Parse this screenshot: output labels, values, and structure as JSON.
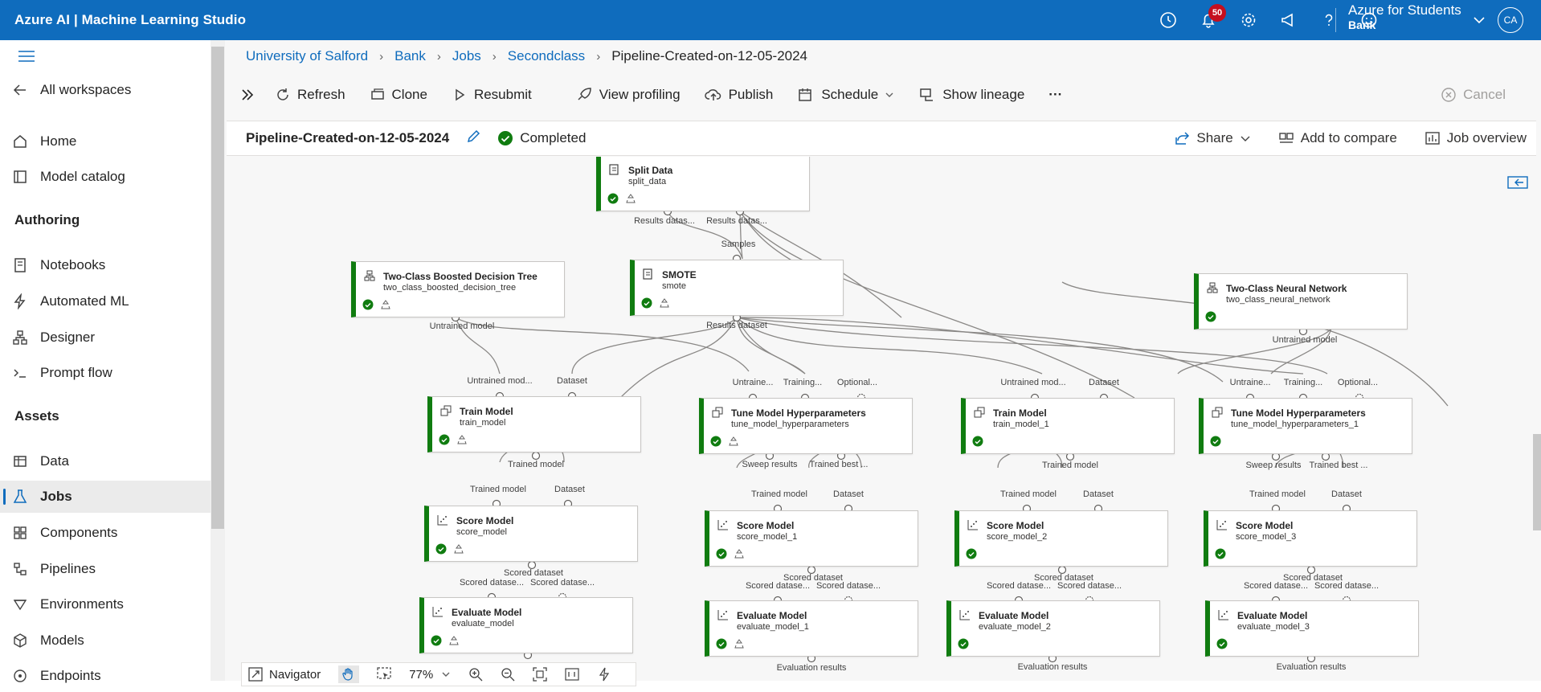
{
  "app": {
    "title": "Azure AI | Machine Learning Studio",
    "notif_count": "50"
  },
  "account": {
    "name": "Azure for Students",
    "workspace": "Bank",
    "initials": "CA"
  },
  "sidebar": {
    "all_workspaces": "All workspaces",
    "items_top": [
      "Home",
      "Model catalog"
    ],
    "authoring_head": "Authoring",
    "authoring": [
      "Notebooks",
      "Automated ML",
      "Designer",
      "Prompt flow"
    ],
    "assets_head": "Assets",
    "assets": [
      "Data",
      "Jobs",
      "Components",
      "Pipelines",
      "Environments",
      "Models",
      "Endpoints"
    ]
  },
  "breadcrumb": [
    "University of Salford",
    "Bank",
    "Jobs",
    "Secondclass",
    "Pipeline-Created-on-12-05-2024"
  ],
  "toolbar": {
    "refresh": "Refresh",
    "clone": "Clone",
    "resubmit": "Resubmit",
    "view_profiling": "View profiling",
    "publish": "Publish",
    "schedule": "Schedule",
    "show_lineage": "Show lineage",
    "more": "···",
    "cancel": "Cancel"
  },
  "job": {
    "name": "Pipeline-Created-on-12-05-2024",
    "status": "Completed",
    "share": "Share",
    "compare": "Add to compare",
    "overview": "Job overview"
  },
  "nodes": {
    "split": {
      "title": "Split Data",
      "sub": "split_data"
    },
    "boosted": {
      "title": "Two-Class Boosted Decision Tree",
      "sub": "two_class_boosted_decision_tree"
    },
    "smote": {
      "title": "SMOTE",
      "sub": "smote"
    },
    "neural": {
      "title": "Two-Class Neural Network",
      "sub": "two_class_neural_network"
    },
    "train": {
      "title": "Train Model",
      "sub": "train_model"
    },
    "tune": {
      "title": "Tune Model Hyperparameters",
      "sub": "tune_model_hyperparameters"
    },
    "train1": {
      "title": "Train Model",
      "sub": "train_model_1"
    },
    "tune1": {
      "title": "Tune Model Hyperparameters",
      "sub": "tune_model_hyperparameters_1"
    },
    "score": {
      "title": "Score Model",
      "sub": "score_model"
    },
    "score1": {
      "title": "Score Model",
      "sub": "score_model_1"
    },
    "score2": {
      "title": "Score Model",
      "sub": "score_model_2"
    },
    "score3": {
      "title": "Score Model",
      "sub": "score_model_3"
    },
    "eval": {
      "title": "Evaluate Model",
      "sub": "evaluate_model"
    },
    "eval1": {
      "title": "Evaluate Model",
      "sub": "evaluate_model_1"
    },
    "eval2": {
      "title": "Evaluate Model",
      "sub": "evaluate_model_2"
    },
    "eval3": {
      "title": "Evaluate Model",
      "sub": "evaluate_model_3"
    }
  },
  "ports": {
    "results_ds1": "Results datas...",
    "results_ds2": "Results datas...",
    "samples": "Samples",
    "untrained_model": "Untrained model",
    "results_dataset": "Results dataset",
    "untrained_mod": "Untrained mod...",
    "dataset": "Dataset",
    "untrained_short": "Untraine...",
    "training": "Training...",
    "optional": "Optional...",
    "trained_model": "Trained model",
    "sweep_results": "Sweep results",
    "trained_best": "Trained best ...",
    "scored_dataset": "Scored dataset",
    "scored_dataset_trunc": "Scored datase...",
    "evaluation_results": "Evaluation results"
  },
  "navigator": {
    "label": "Navigator",
    "zoom": "77%"
  }
}
